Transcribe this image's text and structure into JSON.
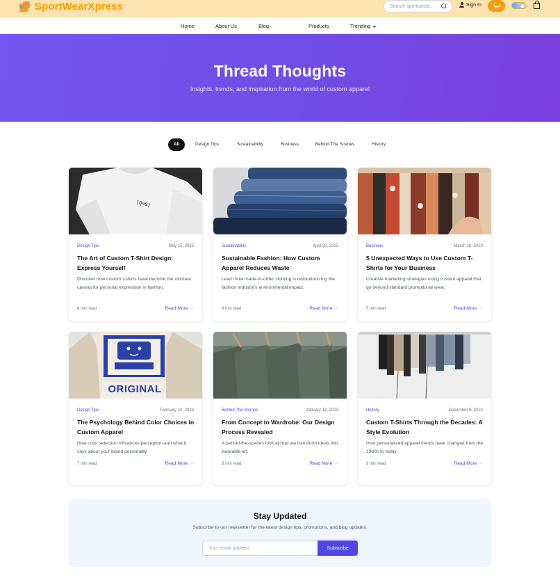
{
  "header": {
    "brand": "SportWearXpress",
    "search_placeholder": "Search sportswear...",
    "signin_label": "Sign In",
    "accent": "#f59e0b"
  },
  "nav": {
    "items": [
      "Home",
      "About Us",
      "Blog",
      "Products",
      "Trending"
    ]
  },
  "hero": {
    "title": "Thread Thoughts",
    "subtitle": "Insights, trends, and inspiration from the world of custom apparel"
  },
  "filters": {
    "items": [
      "All",
      "Design Tips",
      "Sustainability",
      "Business",
      "Behind The Scenes",
      "History"
    ],
    "active": "All"
  },
  "posts": [
    {
      "category": "Design Tips",
      "date": "May 15, 2023",
      "title": "The Art of Custom T-Shirt Design: Express Yourself",
      "excerpt": "Discover how custom t-shirts have become the ultimate canvas for personal expression in fashion.",
      "read_time": "4 min read",
      "read_more": "Read More",
      "image_text": "(Q9S)"
    },
    {
      "category": "Sustainability",
      "date": "April 28, 2023",
      "title": "Sustainable Fashion: How Custom Apparel Reduces Waste",
      "excerpt": "Learn how made-to-order clothing is revolutionizing the fashion industry's environmental impact.",
      "read_time": "6 min read",
      "read_more": "Read More"
    },
    {
      "category": "Business",
      "date": "March 10, 2023",
      "title": "5 Unexpected Ways to Use Custom T-Shirts for Your Business",
      "excerpt": "Creative marketing strategies using custom apparel that go beyond standard promotional wear.",
      "read_time": "5 min read",
      "read_more": "Read More"
    },
    {
      "category": "Design Tips",
      "date": "February 22, 2023",
      "title": "The Psychology Behind Color Choices in Custom Apparel",
      "excerpt": "How color selection influences perception and what it says about your brand personality.",
      "read_time": "7 min read",
      "read_more": "Read More",
      "image_text": "ORIGINAL"
    },
    {
      "category": "Behind The Scenes",
      "date": "January 18, 2023",
      "title": "From Concept to Wardrobe: Our Design Process Revealed",
      "excerpt": "A behind-the-scenes look at how we transform ideas into wearable art.",
      "read_time": "8 min read",
      "read_more": "Read More"
    },
    {
      "category": "History",
      "date": "December 5, 2022",
      "title": "Custom T-Shirts Through the Decades: A Style Evolution",
      "excerpt": "How personalized apparel trends have changed from the 1960s to today.",
      "read_time": "9 min read",
      "read_more": "Read More"
    }
  ],
  "newsletter": {
    "title": "Stay Updated",
    "text": "Subscribe to our newsletter for the latest design tips, promotions, and blog updates.",
    "placeholder": "Your email address",
    "button": "Subscribe"
  }
}
